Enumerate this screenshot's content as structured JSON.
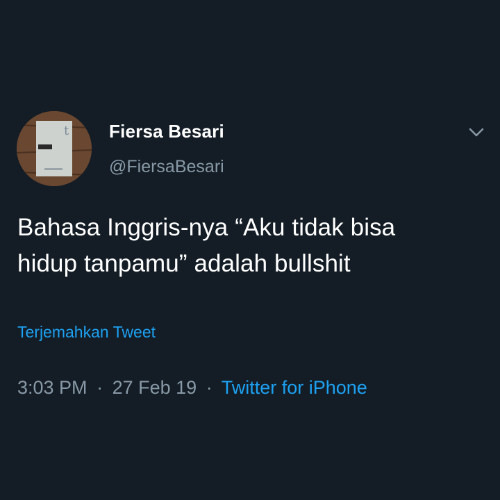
{
  "colors": {
    "background": "#141d26",
    "primary_text": "#ffffff",
    "secondary_text": "#8899a6",
    "link": "#1da1f2"
  },
  "author": {
    "display_name": "Fiersa Besari",
    "handle": "@FiersaBesari",
    "avatar_icon": "book-cover-avatar"
  },
  "tweet": {
    "text_line_1": "Bahasa Inggris-nya “Aku tidak bisa",
    "text_line_2": "hidup tanpamu” adalah bullshit",
    "translate_label": "Terjemahkan Tweet"
  },
  "meta": {
    "time": "3:03 PM",
    "separator": "·",
    "date": "27 Feb 19",
    "source": "Twitter for iPhone"
  },
  "icons": {
    "more_menu": "chevron-down-icon"
  }
}
